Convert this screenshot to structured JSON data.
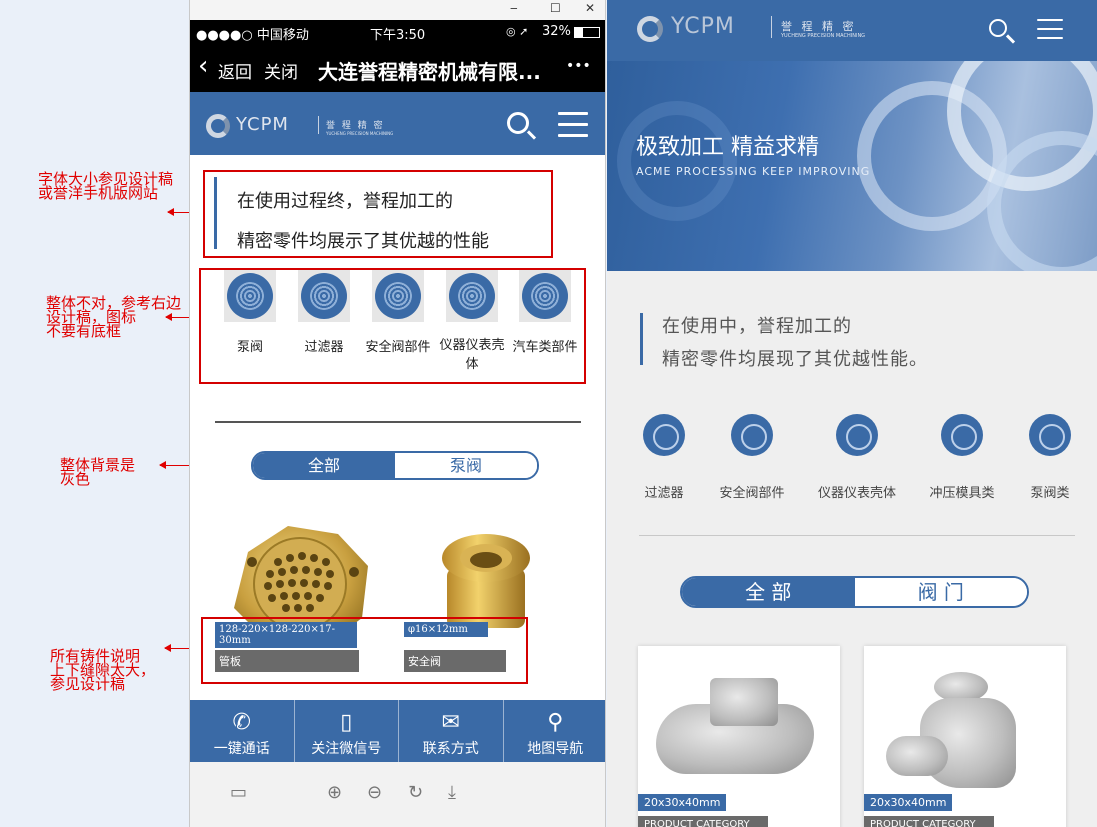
{
  "window": {
    "minimize": "‒",
    "maximize": "☐",
    "close": "✕"
  },
  "phone_status": {
    "carrier": "●●●●○ 中国移动",
    "time": "下午3:50",
    "battery": "32%",
    "icons": "◎ ➚"
  },
  "phone_nav": {
    "back": "返回",
    "close": "关闭",
    "title": "大连誉程精密机械有限...",
    "more": "•••"
  },
  "brand": {
    "logo": "YCPM",
    "name": "誉 程 精 密",
    "sub": "YUCHENG PRECISION MACHINING"
  },
  "mobile": {
    "quote": [
      "在使用过程终，誉程加工的",
      "精密零件均展示了其优越的性能"
    ],
    "categories": [
      "泵阀",
      "过滤器",
      "安全阀部件",
      "仪器仪表壳体",
      "汽车类部件"
    ],
    "tabs": [
      "全部",
      "泵阀"
    ],
    "products": [
      {
        "spec": "128-220×128-220×17-30mm",
        "name": "管板"
      },
      {
        "spec": "φ16×12mm",
        "name": "安全阀"
      }
    ],
    "footer": [
      {
        "icon": "phone-icon",
        "label": "一键通话",
        "glyph": "✆"
      },
      {
        "icon": "mobile-icon",
        "label": "关注微信号",
        "glyph": "▯"
      },
      {
        "icon": "mail-icon",
        "label": "联系方式",
        "glyph": "✉"
      },
      {
        "icon": "map-pin-icon",
        "label": "地图导航",
        "glyph": "⚲"
      }
    ],
    "toolbar": [
      "▭",
      "⊕",
      "⊖",
      "↻",
      "⤓"
    ]
  },
  "annotations": [
    "字体大小参见设计稿\n或誉洋手机版网站",
    "整体不对，参考右边\n设计稿，图标\n不要有底框",
    "整体背景是\n灰色",
    "所有铸件说明\n上下缝隙太大，\n参见设计稿"
  ],
  "design": {
    "banner_title": "极致加工  精益求精",
    "banner_sub": "ACME PROCESSING KEEP IMPROVING",
    "quote": [
      "在使用中，誉程加工的",
      "精密零件均展现了其优越性能。"
    ],
    "categories": [
      "过滤器",
      "安全阀部件",
      "仪器仪表壳体",
      "冲压模具类",
      "泵阀类"
    ],
    "tabs": [
      "全 部",
      "阀 门"
    ],
    "products": [
      {
        "spec": "20x30x40mm",
        "category": "PRODUCT CATEGORY"
      },
      {
        "spec": "20x30x40mm",
        "category": "PRODUCT CATEGORY"
      }
    ]
  },
  "colors": {
    "brand_blue": "#3a6aa6",
    "annotation_red": "#e00000",
    "bg": "#eaf0f9"
  }
}
